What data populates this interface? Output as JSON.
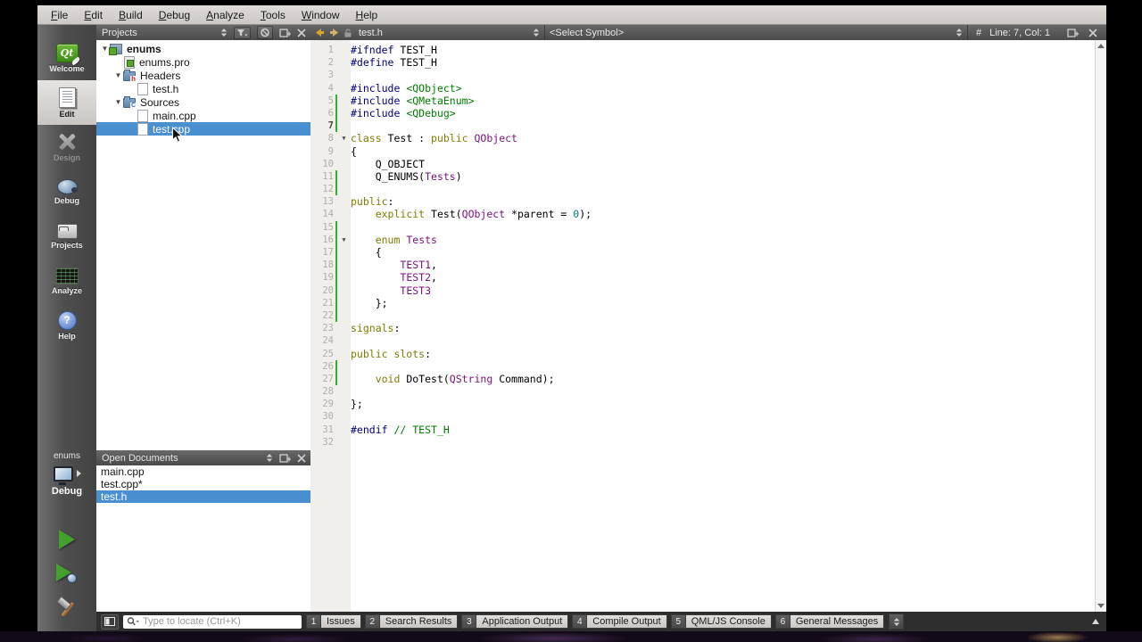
{
  "menu_bar": {
    "items": [
      "File",
      "Edit",
      "Build",
      "Debug",
      "Analyze",
      "Tools",
      "Window",
      "Help"
    ]
  },
  "sidebar": {
    "modes": [
      {
        "id": "welcome",
        "label": "Welcome",
        "icon": "qt-logo-icon",
        "state": "normal"
      },
      {
        "id": "edit",
        "label": "Edit",
        "icon": "edit-document-icon",
        "state": "selected"
      },
      {
        "id": "design",
        "label": "Design",
        "icon": "design-tools-icon",
        "state": "disabled"
      },
      {
        "id": "debug",
        "label": "Debug",
        "icon": "debug-bug-icon",
        "state": "normal"
      },
      {
        "id": "projects",
        "label": "Projects",
        "icon": "projects-folder-icon",
        "state": "normal"
      },
      {
        "id": "analyze",
        "label": "Analyze",
        "icon": "analyze-screen-icon",
        "state": "normal"
      },
      {
        "id": "help",
        "label": "Help",
        "icon": "help-question-icon",
        "state": "normal"
      }
    ],
    "target_selector": {
      "project_name": "enums",
      "build_config": "Debug",
      "icon": "computer-icon",
      "expander_icon": "right-triangle-icon"
    },
    "run_controls": [
      {
        "id": "run",
        "icon": "run-play-icon"
      },
      {
        "id": "run-debug",
        "icon": "debug-play-icon"
      },
      {
        "id": "build",
        "icon": "build-hammer-icon"
      }
    ]
  },
  "projects_panel": {
    "title": "Projects",
    "toolbar_icons": [
      "combo-arrows-icon",
      "filter-icon",
      "sync-icon",
      "split-icon",
      "close-icon"
    ],
    "tree": [
      {
        "label": "enums",
        "depth": 0,
        "expanded": true,
        "bold": true,
        "icon": "qt-project-icon",
        "selected": false
      },
      {
        "label": "enums.pro",
        "depth": 1,
        "icon": "pro-file-icon",
        "selected": false
      },
      {
        "label": "Headers",
        "depth": 1,
        "expanded": true,
        "icon": "headers-folder-icon",
        "selected": false
      },
      {
        "label": "test.h",
        "depth": 2,
        "icon": "header-file-icon",
        "selected": false
      },
      {
        "label": "Sources",
        "depth": 1,
        "expanded": true,
        "icon": "sources-folder-icon",
        "selected": false
      },
      {
        "label": "main.cpp",
        "depth": 2,
        "icon": "cpp-file-icon",
        "selected": false
      },
      {
        "label": "test.cpp",
        "depth": 2,
        "icon": "cpp-file-icon",
        "selected": true
      }
    ]
  },
  "open_documents_panel": {
    "title": "Open Documents",
    "toolbar_icons": [
      "combo-arrows-icon",
      "split-icon",
      "close-icon"
    ],
    "documents": [
      {
        "label": "main.cpp",
        "selected": false
      },
      {
        "label": "test.cpp*",
        "selected": false
      },
      {
        "label": "test.h",
        "selected": true
      }
    ]
  },
  "editor": {
    "toolbar": {
      "file_name": "test.h",
      "symbol_selector": "<Select Symbol>",
      "hash_symbol": "#",
      "line_col": "Line: 7, Col: 1"
    },
    "current_line": 7,
    "fold_marker_lines": [
      8,
      16
    ],
    "changed_lines": [
      5,
      6,
      7,
      11,
      12,
      15,
      16,
      17,
      18,
      19,
      20,
      21,
      22,
      26,
      27
    ],
    "lines": [
      [
        [
          "#ifndef",
          "pp"
        ],
        [
          " TEST_H",
          ""
        ]
      ],
      [
        [
          "#define",
          "pp"
        ],
        [
          " TEST_H",
          ""
        ]
      ],
      [],
      [
        [
          "#include",
          "pp"
        ],
        [
          " ",
          ""
        ],
        [
          "<QObject>",
          "grn"
        ]
      ],
      [
        [
          "#include",
          "pp"
        ],
        [
          " ",
          ""
        ],
        [
          "<QMetaEnum>",
          "grn"
        ]
      ],
      [
        [
          "#include",
          "pp"
        ],
        [
          " ",
          ""
        ],
        [
          "<QDebug>",
          "grn"
        ]
      ],
      [],
      [
        [
          "class",
          "kw"
        ],
        [
          " Test : ",
          ""
        ],
        [
          "public",
          "kw"
        ],
        [
          " ",
          ""
        ],
        [
          "QObject",
          "typ"
        ]
      ],
      [
        [
          "{",
          ""
        ]
      ],
      [
        [
          "    Q_OBJECT",
          ""
        ]
      ],
      [
        [
          "    Q_ENUMS(",
          ""
        ],
        [
          "Tests",
          "typ"
        ],
        [
          ")",
          ""
        ]
      ],
      [],
      [
        [
          "public",
          "kw"
        ],
        [
          ":",
          ""
        ]
      ],
      [
        [
          "    ",
          ""
        ],
        [
          "explicit",
          "kw"
        ],
        [
          " Test(",
          ""
        ],
        [
          "QObject",
          "typ"
        ],
        [
          " *parent = ",
          ""
        ],
        [
          "0",
          "num"
        ],
        [
          ");",
          ""
        ]
      ],
      [],
      [
        [
          "    ",
          ""
        ],
        [
          "enum",
          "kw"
        ],
        [
          " ",
          ""
        ],
        [
          "Tests",
          "typ"
        ]
      ],
      [
        [
          "    {",
          ""
        ]
      ],
      [
        [
          "        ",
          ""
        ],
        [
          "TEST1",
          "typ"
        ],
        [
          ",",
          ""
        ]
      ],
      [
        [
          "        ",
          ""
        ],
        [
          "TEST2",
          "typ"
        ],
        [
          ",",
          ""
        ]
      ],
      [
        [
          "        ",
          ""
        ],
        [
          "TEST3",
          "typ"
        ]
      ],
      [
        [
          "    };",
          ""
        ]
      ],
      [],
      [
        [
          "signals",
          "kw"
        ],
        [
          ":",
          ""
        ]
      ],
      [],
      [
        [
          "public slots",
          "kw"
        ],
        [
          ":",
          ""
        ]
      ],
      [],
      [
        [
          "    ",
          ""
        ],
        [
          "void",
          "kw"
        ],
        [
          " DoTest(",
          ""
        ],
        [
          "QString",
          "typ"
        ],
        [
          " Command);",
          ""
        ]
      ],
      [],
      [
        [
          "};",
          ""
        ]
      ],
      [],
      [
        [
          "#endif",
          "pp"
        ],
        [
          " ",
          ""
        ],
        [
          "// TEST_H",
          "grn"
        ]
      ],
      []
    ]
  },
  "bottom_bar": {
    "locator": {
      "placeholder": "Type to locate (Ctrl+K)",
      "icon": "magnifier-icon"
    },
    "sidebar_toggle_icon": "sidebar-toggle-icon",
    "output_panes": [
      {
        "number": "1",
        "label": "Issues"
      },
      {
        "number": "2",
        "label": "Search Results"
      },
      {
        "number": "3",
        "label": "Application Output"
      },
      {
        "number": "4",
        "label": "Compile Output"
      },
      {
        "number": "5",
        "label": "QML/JS Console"
      },
      {
        "number": "6",
        "label": "General Messages"
      }
    ]
  },
  "colors": {
    "selection_blue": "#4a8fd0",
    "change_bar_green": "#2db52d",
    "syntax_preprocessor": "#000080",
    "syntax_string_comment_green": "#008000",
    "syntax_keyword_olive": "#7e7e00",
    "syntax_type_purple": "#7d107d",
    "syntax_number_teal": "#008080",
    "nav_arrow_gold": "#d8a52f",
    "panel_header_gray": "#4a4a4a",
    "bottom_bar_gray": "#2e2e2e"
  }
}
